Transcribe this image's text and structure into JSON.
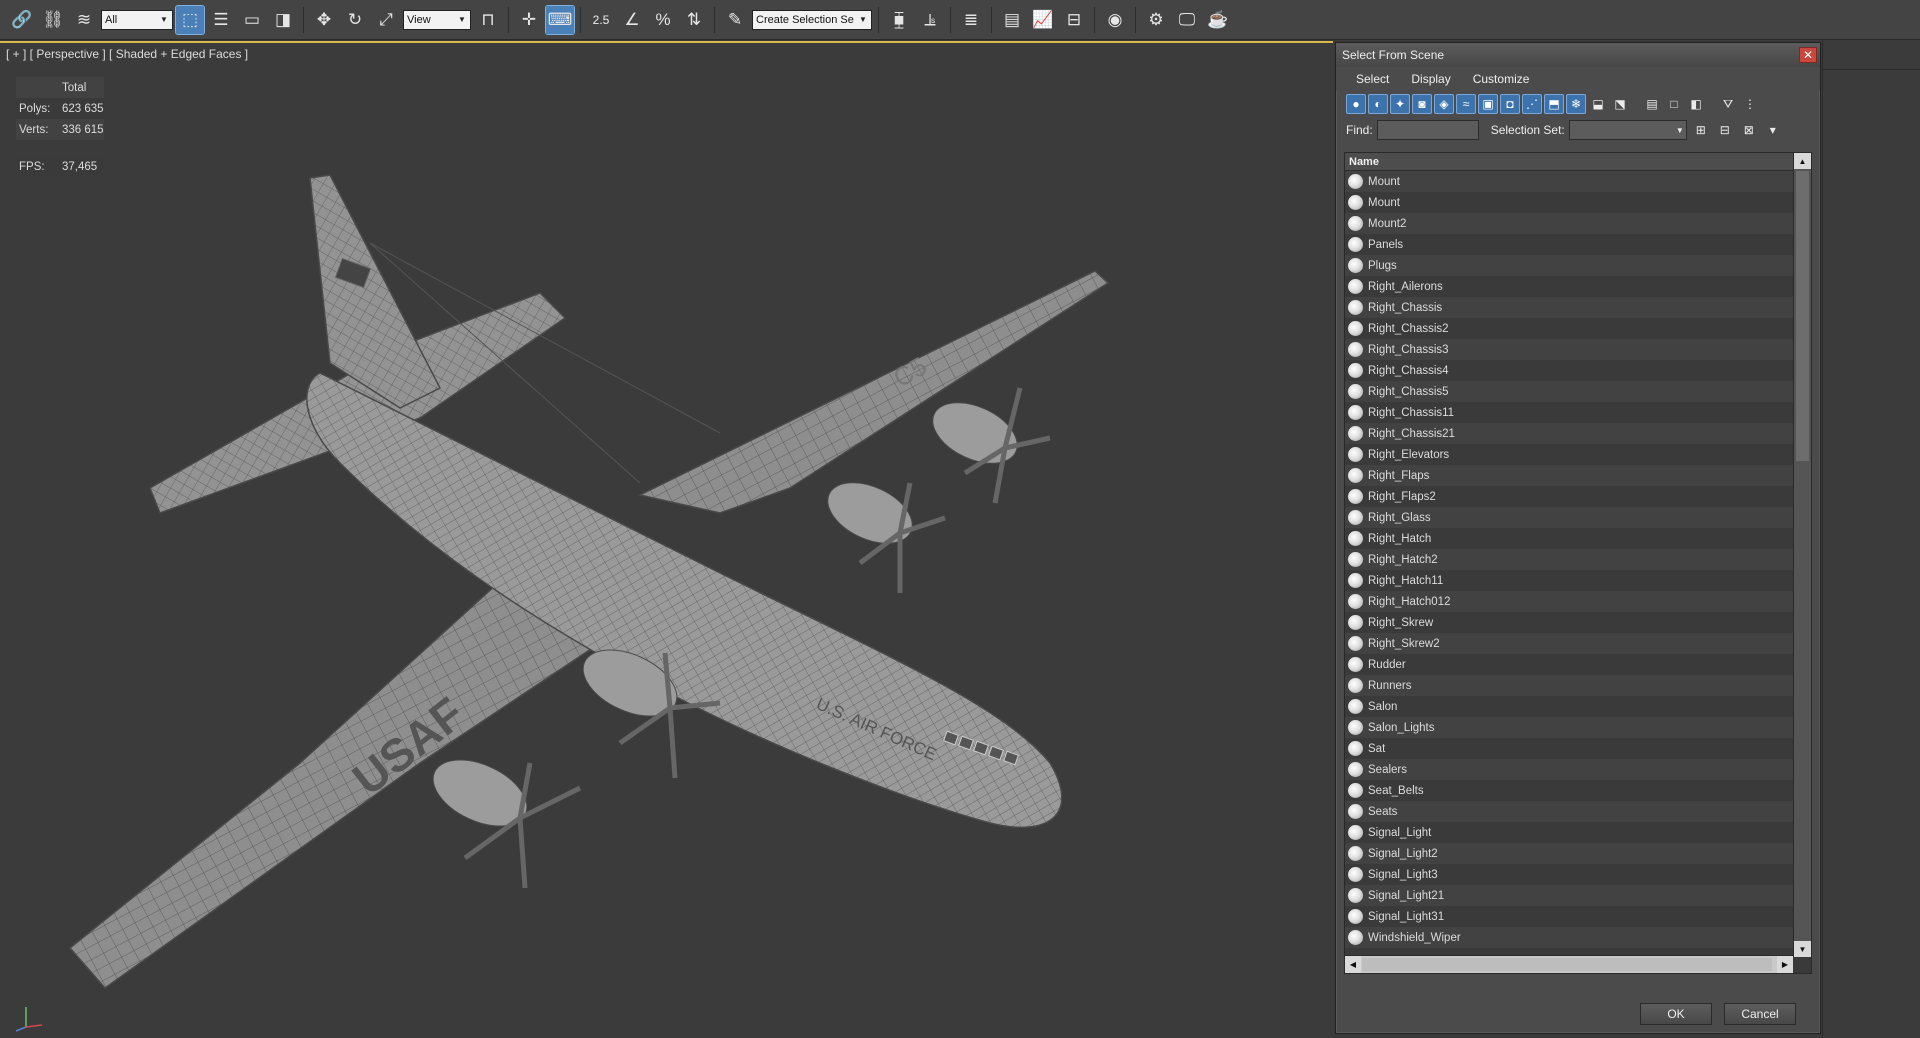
{
  "toolbar": {
    "filter_value": "All",
    "view_value": "View",
    "snap_label": "2.5",
    "selection_set_placeholder": "Create Selection Se"
  },
  "viewport": {
    "label": "[ + ] [ Perspective ] [ Shaded + Edged Faces ]",
    "stats": {
      "total_label": "Total",
      "polys_label": "Polys:",
      "polys_value": "623 635",
      "verts_label": "Verts:",
      "verts_value": "336 615",
      "fps_label": "FPS:",
      "fps_value": "37,465"
    },
    "model": {
      "wing_marking": "USAF",
      "fuselage_marking": "U.S. AIR FORCE",
      "wing_marking_upper": "C5"
    }
  },
  "dialog": {
    "title": "Select From Scene",
    "menu": [
      "Select",
      "Display",
      "Customize"
    ],
    "find_label": "Find:",
    "find_value": "",
    "selection_set_label": "Selection Set:",
    "column_header": "Name",
    "items": [
      "Mount",
      "Mount",
      "Mount2",
      "Panels",
      "Plugs",
      "Right_Ailerons",
      "Right_Chassis",
      "Right_Chassis2",
      "Right_Chassis3",
      "Right_Chassis4",
      "Right_Chassis5",
      "Right_Chassis11",
      "Right_Chassis21",
      "Right_Elevators",
      "Right_Flaps",
      "Right_Flaps2",
      "Right_Glass",
      "Right_Hatch",
      "Right_Hatch2",
      "Right_Hatch11",
      "Right_Hatch012",
      "Right_Skrew",
      "Right_Skrew2",
      "Rudder",
      "Runners",
      "Salon",
      "Salon_Lights",
      "Sat",
      "Sealers",
      "Seat_Belts",
      "Seats",
      "Signal_Light",
      "Signal_Light2",
      "Signal_Light3",
      "Signal_Light21",
      "Signal_Light31",
      "Windshield_Wiper"
    ],
    "ok_label": "OK",
    "cancel_label": "Cancel"
  },
  "colors": {
    "accent": "#4a7fb8",
    "stats": "#e8c340",
    "viewport_border": "#d8b94a",
    "close": "#c9473c"
  }
}
